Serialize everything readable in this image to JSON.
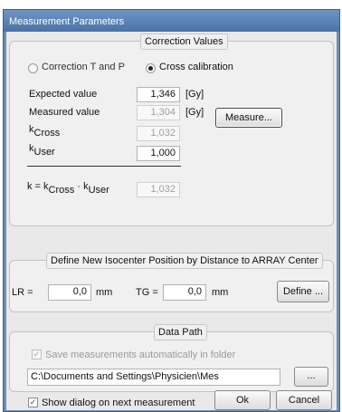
{
  "window": {
    "title": "Measurement Parameters"
  },
  "correction": {
    "legend": "Correction Values",
    "radio_tp_label": "Correction T and P",
    "radio_cross_label": "Cross calibration",
    "expected_label": "Expected value",
    "expected_value": "1,346",
    "expected_unit": "[Gy]",
    "measured_label": "Measured value",
    "measured_value": "1,304",
    "measured_unit": "[Gy]",
    "measure_button": "Measure...",
    "kcross_k": "k",
    "kcross_sub": "Cross",
    "kcross_value": "1,032",
    "kuser_k": "k",
    "kuser_sub": "User",
    "kuser_value": "1,000",
    "formula_prefix": "k = k",
    "formula_cross": "Cross",
    "formula_dot": " · ",
    "formula_k": "k",
    "formula_user": "User",
    "formula_value": "1,032"
  },
  "isocenter": {
    "legend": "Define New Isocenter Position by Distance to ARRAY Center",
    "lr_label": "LR =",
    "lr_value": "0,0",
    "lr_unit": "mm",
    "tg_label": "TG =",
    "tg_value": "0,0",
    "tg_unit": "mm",
    "define_button": "Define ..."
  },
  "datapath": {
    "legend": "Data Path",
    "save_auto_label": "Save measurements automatically in folder",
    "path_value": "C:\\Documents and Settings\\Physicien\\Mes documents\\An",
    "browse_button": "..."
  },
  "footer": {
    "show_dialog_label": "Show dialog on next measurement",
    "ok_button": "Ok",
    "cancel_button": "Cancel"
  }
}
